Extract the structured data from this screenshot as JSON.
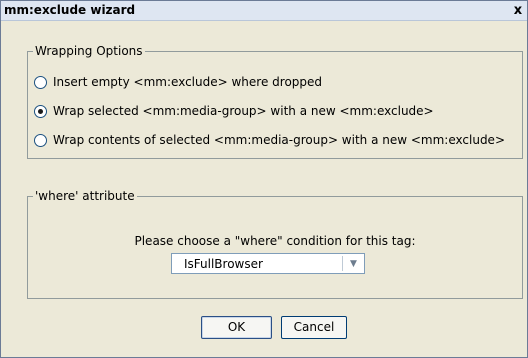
{
  "window": {
    "title": "mm:exclude wizard",
    "close_glyph": "x"
  },
  "wrapping_options": {
    "legend": "Wrapping Options",
    "options": [
      {
        "label": "Insert empty <mm:exclude> where dropped",
        "checked": false
      },
      {
        "label": "Wrap selected <mm:media-group> with a new <mm:exclude>",
        "checked": true
      },
      {
        "label": "Wrap contents of selected <mm:media-group> with a new <mm:exclude>",
        "checked": false
      }
    ]
  },
  "where_attribute": {
    "legend": "'where' attribute",
    "prompt": "Please choose a \"where\" condition for this tag:",
    "selected_value": "IsFullBrowser",
    "arrow_glyph": "▼"
  },
  "buttons": {
    "ok": "OK",
    "cancel": "Cancel"
  }
}
